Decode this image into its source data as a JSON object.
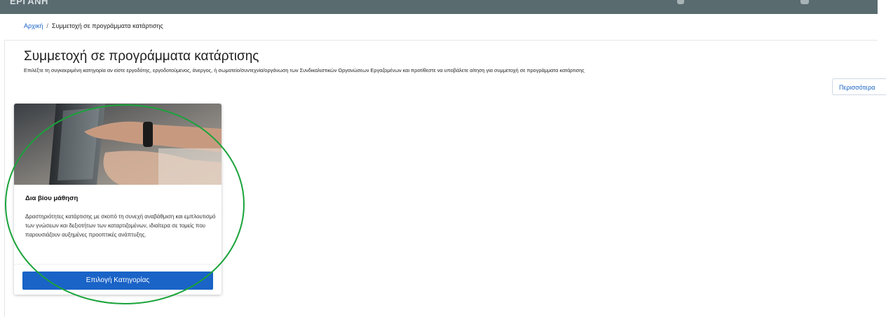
{
  "header": {
    "logo_text": "ΕΡΓΑΝΗ",
    "brand_color": "#5a6b70",
    "accent_color": "#1a63c7"
  },
  "breadcrumb": {
    "home": "Αρχική",
    "separator": "/",
    "current": "Συμμετοχή σε προγράμματα κατάρτισης"
  },
  "main": {
    "title": "Συμμετοχή σε προγράμματα κατάρτισης",
    "description": "Επιλέξτε τη συγκεκριμένη κατηγορία αν είστε εργοδότης, εργοδοτούμενος, άνεργος, ή σωματείο/συντεχνία/οργάνωση των Συνδικαλιστικών Οργανώσεων Εργαζομένων και προτίθεστε να υποβάλετε αίτηση για συμμετοχή σε προγράμματα κατάρτισης",
    "more_label": "Περισσότερα"
  },
  "card": {
    "image_icon": "touchscreen-photo",
    "title": "Δια βίου μάθηση",
    "text": "Δραστηριότητες κατάρτισης με σκοπό τη συνεχή αναβάθμιση και εμπλουτισμό των γνώσεων και δεξιοτήτων των καταρτιζομένων, ιδιαίτερα σε τομείς που παρουσιάζουν αυξημένες προοπτικές ανάπτυξης.",
    "button_label": "Επιλογή Κατηγορίας"
  },
  "annotation": {
    "shape": "ellipse",
    "color": "#1aa33a"
  }
}
